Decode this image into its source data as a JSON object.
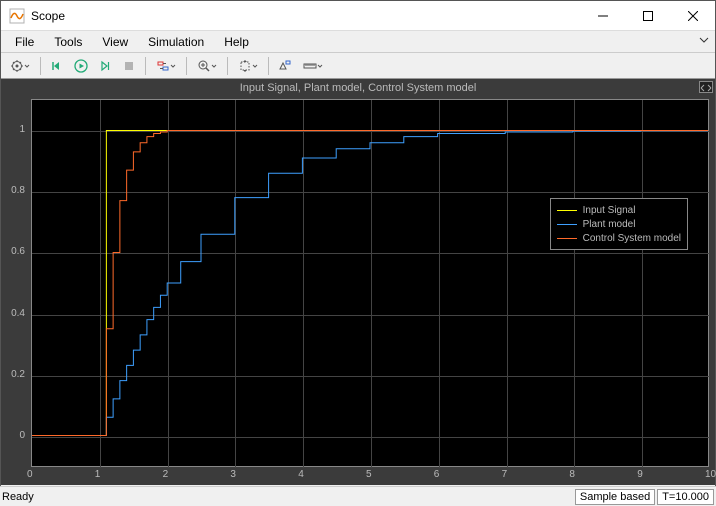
{
  "window": {
    "title": "Scope"
  },
  "menu": {
    "file": "File",
    "tools": "Tools",
    "view": "View",
    "simulation": "Simulation",
    "help": "Help"
  },
  "plot": {
    "title": "Input Signal, Plant model, Control System model",
    "x_ticks": [
      "0",
      "1",
      "2",
      "3",
      "4",
      "5",
      "6",
      "7",
      "8",
      "9",
      "10"
    ],
    "y_ticks": [
      "0",
      "0.2",
      "0.4",
      "0.6",
      "0.8",
      "1"
    ],
    "legend": {
      "s1": "Input Signal",
      "s2": "Plant model",
      "s3": "Control System model"
    }
  },
  "colors": {
    "s1": "#ffff00",
    "s2": "#3ea0ff",
    "s3": "#ff6a2a"
  },
  "status": {
    "ready": "Ready",
    "sample": "Sample based",
    "time": "T=10.000"
  },
  "chart_data": {
    "type": "line",
    "title": "Input Signal, Plant model, Control System model",
    "xlabel": "",
    "ylabel": "",
    "xlim": [
      0,
      10
    ],
    "ylim": [
      -0.1,
      1.1
    ],
    "x": [
      0,
      0.5,
      1,
      1.1,
      1.2,
      1.3,
      1.4,
      1.5,
      1.6,
      1.7,
      1.8,
      1.9,
      2,
      2.2,
      2.5,
      3,
      3.5,
      4,
      4.5,
      5,
      5.5,
      6,
      7,
      8,
      9,
      10
    ],
    "series": [
      {
        "name": "Input Signal",
        "values": [
          0,
          0,
          0,
          1,
          1,
          1,
          1,
          1,
          1,
          1,
          1,
          1,
          1,
          1,
          1,
          1,
          1,
          1,
          1,
          1,
          1,
          1,
          1,
          1,
          1,
          1
        ]
      },
      {
        "name": "Plant model",
        "values": [
          0,
          0,
          0,
          0.06,
          0.12,
          0.18,
          0.23,
          0.28,
          0.33,
          0.38,
          0.42,
          0.46,
          0.5,
          0.57,
          0.66,
          0.78,
          0.86,
          0.91,
          0.94,
          0.96,
          0.98,
          0.99,
          0.995,
          0.998,
          0.999,
          1
        ]
      },
      {
        "name": "Control System model",
        "values": [
          0,
          0,
          0,
          0.35,
          0.6,
          0.77,
          0.87,
          0.93,
          0.96,
          0.98,
          0.99,
          0.995,
          1,
          1,
          1,
          1,
          1,
          1,
          1,
          1,
          1,
          1,
          1,
          1,
          1,
          1
        ]
      }
    ]
  }
}
